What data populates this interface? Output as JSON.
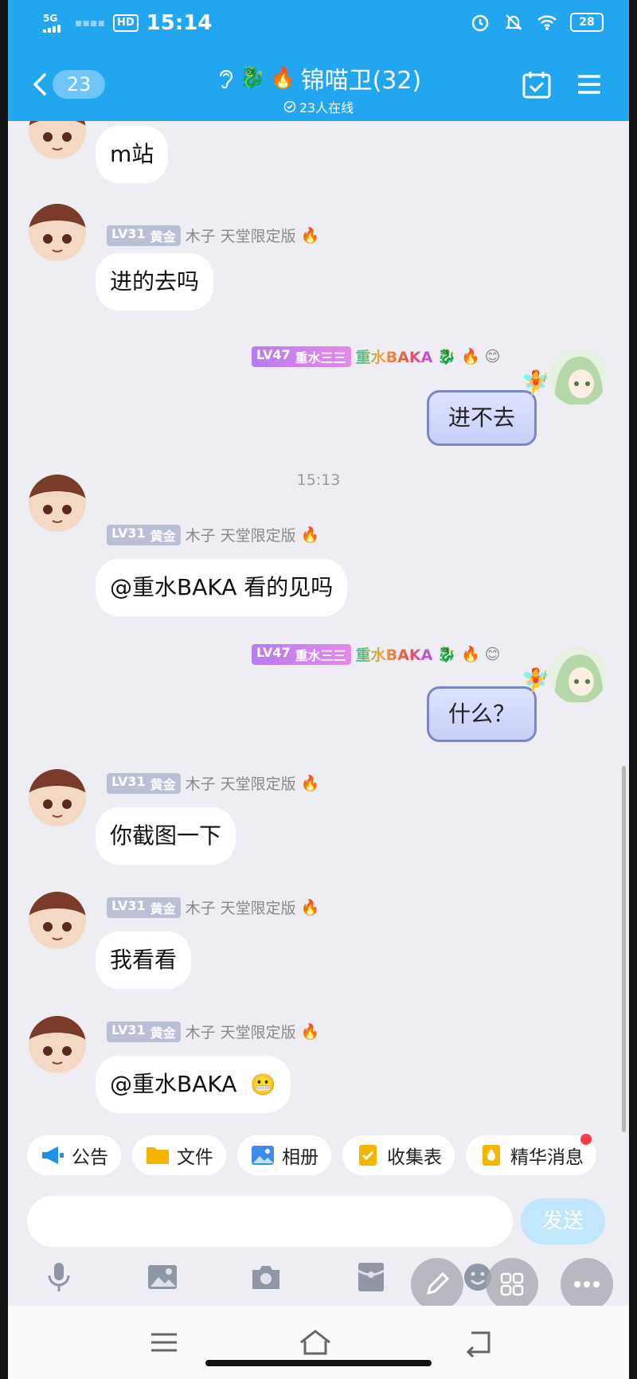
{
  "status_bar": {
    "network": "5G",
    "hd": "HD",
    "time": "15:14",
    "battery": "28"
  },
  "header": {
    "back_count": "23",
    "group_name": "锦喵卫(32)",
    "online": "23人在线"
  },
  "user_other": {
    "level": "LV31",
    "rank": "黄金",
    "name": "木子",
    "title": "天堂限定版"
  },
  "user_self": {
    "level": "LV47",
    "rank": "重水三三",
    "name": "重水BAKA"
  },
  "messages": [
    {
      "text": "m站"
    },
    {
      "text": "进的去吗"
    },
    {
      "text": "进不去"
    },
    {
      "text": "@重水BAKA  看的见吗"
    },
    {
      "text": "什么？"
    },
    {
      "text": "你截图一下"
    },
    {
      "text": "我看看"
    },
    {
      "text": "@重水BAKA "
    }
  ],
  "timestamp": "15:13",
  "quick_actions": [
    {
      "label": "公告",
      "icon": "megaphone-icon"
    },
    {
      "label": "文件",
      "icon": "folder-icon"
    },
    {
      "label": "相册",
      "icon": "photo-album-icon"
    },
    {
      "label": "收集表",
      "icon": "checklist-icon"
    },
    {
      "label": "精华消息",
      "icon": "essence-icon"
    }
  ],
  "send_label": "发送",
  "colors": {
    "header": "#22a6f0",
    "background": "#ededf3",
    "send_disabled": "#bfe6fb"
  }
}
